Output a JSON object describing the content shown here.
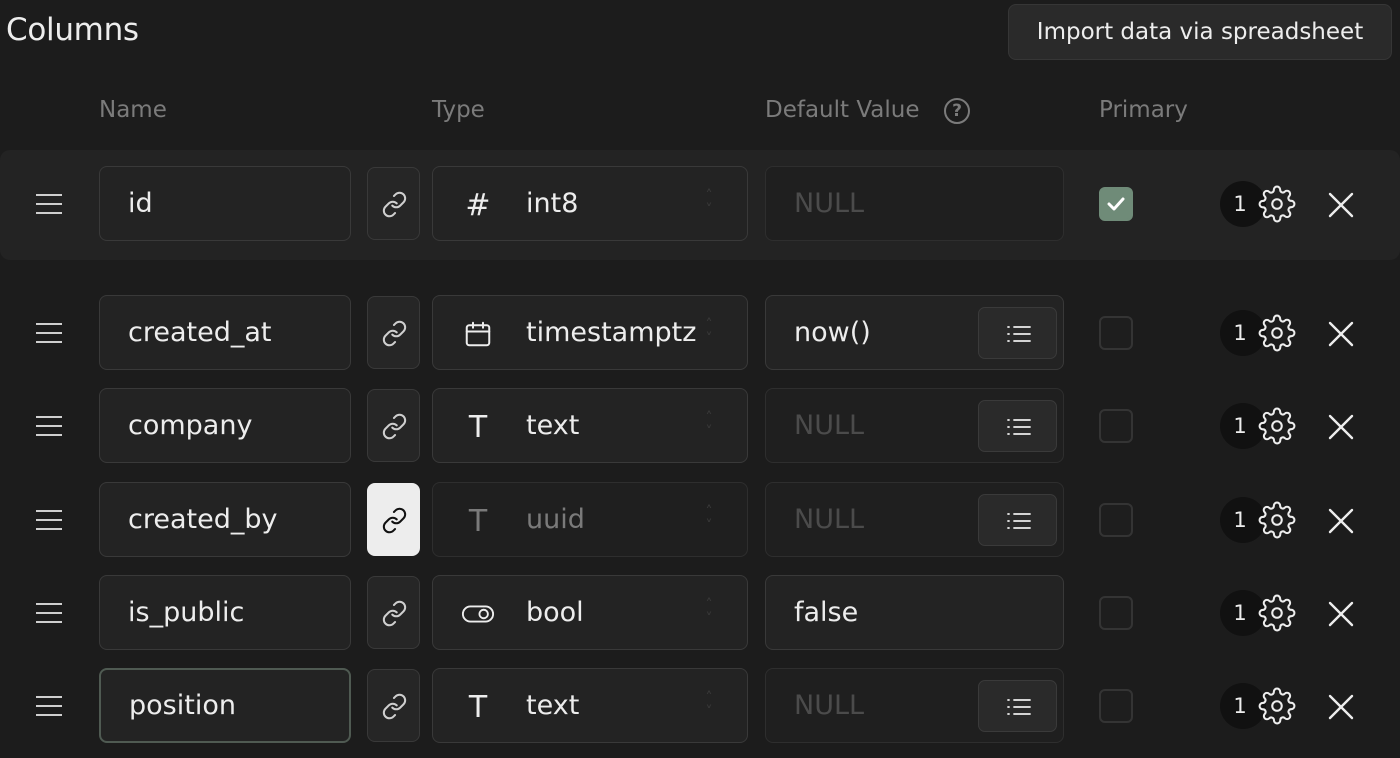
{
  "title": "Columns",
  "import_button": "Import data via spreadsheet",
  "headers": {
    "name": "Name",
    "type": "Type",
    "default_value": "Default Value",
    "primary": "Primary",
    "help_glyph": "?"
  },
  "colors": {
    "background": "#1c1c1c",
    "accent_checked": "#6f8b78"
  },
  "rows": [
    {
      "name": "id",
      "type": "int8",
      "type_icon": "hash-icon",
      "type_glyph": "#",
      "default": "NULL",
      "default_is_null": true,
      "has_list_button": false,
      "primary": true,
      "badge": "1",
      "link_active": false,
      "type_disabled": false,
      "name_focused": false
    },
    {
      "name": "created_at",
      "type": "timestamptz",
      "type_icon": "calendar-icon",
      "type_glyph": "",
      "default": "now()",
      "default_is_null": false,
      "has_list_button": true,
      "primary": false,
      "badge": "1",
      "link_active": false,
      "type_disabled": false,
      "name_focused": false
    },
    {
      "name": "company",
      "type": "text",
      "type_icon": "text-type-icon",
      "type_glyph": "T",
      "default": "NULL",
      "default_is_null": true,
      "has_list_button": true,
      "primary": false,
      "badge": "1",
      "link_active": false,
      "type_disabled": false,
      "name_focused": false
    },
    {
      "name": "created_by",
      "type": "uuid",
      "type_icon": "text-type-icon",
      "type_glyph": "T",
      "default": "NULL",
      "default_is_null": true,
      "has_list_button": true,
      "primary": false,
      "badge": "1",
      "link_active": true,
      "type_disabled": true,
      "name_focused": false
    },
    {
      "name": "is_public",
      "type": "bool",
      "type_icon": "toggle-icon",
      "type_glyph": "",
      "default": "false",
      "default_is_null": false,
      "has_list_button": false,
      "primary": false,
      "badge": "1",
      "link_active": false,
      "type_disabled": false,
      "name_focused": false
    },
    {
      "name": "position",
      "type": "text",
      "type_icon": "text-type-icon",
      "type_glyph": "T",
      "default": "NULL",
      "default_is_null": true,
      "has_list_button": true,
      "primary": false,
      "badge": "1",
      "link_active": false,
      "type_disabled": false,
      "name_focused": true
    }
  ]
}
